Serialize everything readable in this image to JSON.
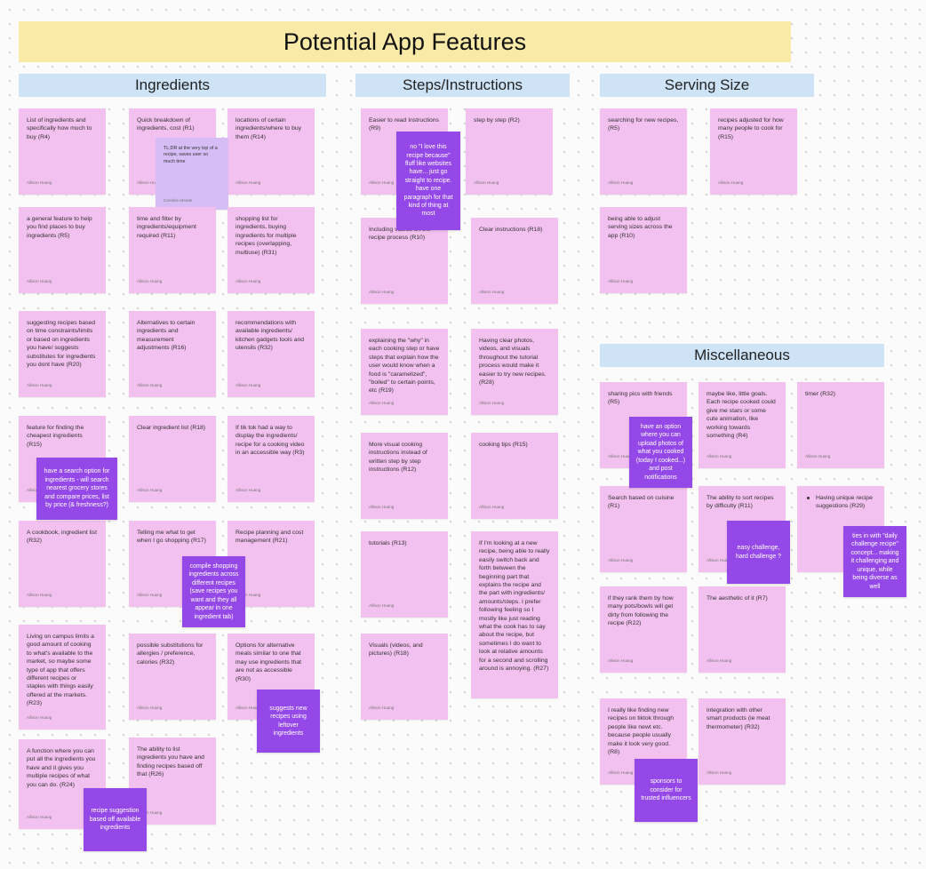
{
  "board": {
    "title": "Potential App Features",
    "sections": {
      "ingredients": "Ingredients",
      "steps": "Steps/Instructions",
      "serving": "Serving Size",
      "misc": "Miscellaneous"
    },
    "author": "Allison Huang",
    "author2": "Caroline Meade"
  },
  "notes": {
    "ing_r1_c1": "List of ingredients and\nspecifically how much to\nbuy (R4)",
    "ing_r1_c2": "Quick breakdown of\ningredients, cost (R1)",
    "ing_r1_c3": "locations of certain\ningredients/where to buy\nthem (R14)",
    "ing_tldr": "TL;DR at the very top of a\nrecipe, saves user so\nmuch time",
    "ing_r2_c1": "a general feature to help\nyou find places to buy\ningredients (R5)",
    "ing_r2_c2": "time and filter by\ningredients/equipment\nrequired (R11)",
    "ing_r2_c3": "shopping list for\ningredients, buying\ningredients for multiple\nrecipes (overlapping,\nmultiuse) (R31)",
    "ing_r3_c1": "suggesting recipes based\non time constraints/limits\nor based on ingredients\nyou have/ suggests\nsubstitutes for ingredients\nyou dont have (R20)",
    "ing_r3_c2": "Alternatives to certain\ningredients and\nmeasurement\nadjustments (R16)",
    "ing_r3_c3": "recommendations with\navailable ingredients/\nkitchen gadgets tools and\nutensils (R32)",
    "ing_r4_c1": "feature for finding the\ncheapest ingredients\n(R15)",
    "ing_r4_c2": "Clear ingredient list (R18)",
    "ing_r4_c3": "If tik tok had a way to\ndisplay the ingredients/\nrecipe for a cooking video\nin an accessible way (R3)",
    "ing_r5_c1": "A cookbook, ingredient list\n(R32)",
    "ing_r5_c2": "Telling me what to get\nwhen I go shopping (R17)",
    "ing_r5_c3": "Recipe planning and cost\nmanagement (R21)",
    "ing_r6_c1": "Living on campus limits a\ngood amount of cooking\nto what's available to the\nmarket, so maybe some\ntype of app that offers\ndifferent recipes or\nstaples with things easily\noffered at the markets.\n(R23)",
    "ing_r6_c2": "possible substitutions for\nallergies / preference,\ncalories (R32)",
    "ing_r6_c3": "Options for alternative\nmeals similar to one that\nmay use ingredients that\nare not as accessible\n(R30)",
    "ing_r7_c1": "A function where you can\nput all the ingredients you\nhave and it gives you\nmultiple recipes of what\nyou can do. (R24)",
    "ing_r7_c2": "The ability to list\ningredients you have and\nfinding recipes based off\nthat (R26)",
    "st_a1": "Easier to read Instructions\n(R9)",
    "st_b1": "step by step (R2)",
    "st_a2": "Including videos on the\nrecipe process (R10)",
    "st_b2": "Clear instructions  (R18)",
    "st_a3": "explaining the \"why\" in\neach cooking step or have\nsteps that explain how the\nuser would know when a\nfood is \"caramelized\",\n\"boiled\" to certain points,\netc (R19)",
    "st_b3": "Having clear photos,\nvideos, and visuals\nthroughout the tutorial\nprocess would make it\neasier to try new recipes.\n(R28)",
    "st_a4": "More visual cooking\ninstructions instead of\nwritten step by step\ninstructions (R12)",
    "st_b4": "cooking tips (R15)",
    "st_a5": "tutorials (R13)",
    "st_b5": "If I'm looking at a new\nrecipe, being able to really\neasily switch back and\nforth between the\nbeginning part that\nexplains the recipe and\nthe part with ingredients/\namounts/steps. I prefer\nfollowing feeling so I\nmostly like just reading\nwhat the cook has to say\nabout the recipe, but\nsometimes I do want to\nlook at relative amounts\nfor a second and scrolling\naround is annoying. (R27)",
    "st_a6": "Visuals (videos, and\npictures) (R18)",
    "sv_a1": "searching for new recipes,\n(R5)",
    "sv_b1": "recipes adjusted for how\nmany people to cook for\n(R15)",
    "sv_a2": "being able to adjust\nserving sizes across the\napp (R10)",
    "mi_a1": "sharing pics with friends\n(R5)",
    "mi_b1": "maybe like, little goals.\nEach recipe cooked could\ngive me stars or some\ncute animation, like\nworking towards\nsomething (R4)",
    "mi_c1": "timer (R32)",
    "mi_a2": "Search based on cuisine\n(R1)",
    "mi_b2": "The ability to sort recipes\nby difficulty (R11)",
    "mi_c2": "Having unique recipe\nsuggestions (R29)",
    "mi_a3": "if they rank them by how\nmany pots/bowls will get\ndirty from following the\nrecipe (R22)",
    "mi_b3": "The aesthetic of it (R7)",
    "mi_a4": "I really like finding new\nrecipes on tiktok through\npeople like newt etc.\nbecause people usually\nmake it look very good.\n(R8)",
    "mi_b4": "integration with other\nsmart products (ie meat\nthermometer) (R32)"
  },
  "comments": {
    "steps_fluff": "no \"I love this\nrecipe because\"\nfluff like websites\nhave... just go\nstraight to recipe.\nhave one\nparagraph for that\nkind of thing at\nmost",
    "ing_search": "have a search option for\ningredients - will search\nnearest grocery stores\nand compare prices, list\nby price (& freshness?)",
    "ing_compile": "compile shopping\ningredients across\ndifferent recipes\n(save recipes you\nwant and they all\nappear in one\ningredient tab)",
    "ing_suggest_new": "suggests new\nrecipes using\nleftover\ningredients",
    "ing_suggestion": "recipe suggestion\nbased off available\ningredients",
    "mi_upload": "have an option\nwhere you can\nupload photos of\nwhat you cooked\n(today I cooked...)\nand post\nnotifications",
    "mi_easy": "easy challenge,\nhard challenge ?",
    "mi_daily": "ties in with \"daily\nchallenge recipe\"\nconcept... making\nit challenging and\nunique, while\nbeing diverse as\nwell",
    "mi_sponsors": "sponsors to\nconsider for\ntrusted influencers"
  }
}
